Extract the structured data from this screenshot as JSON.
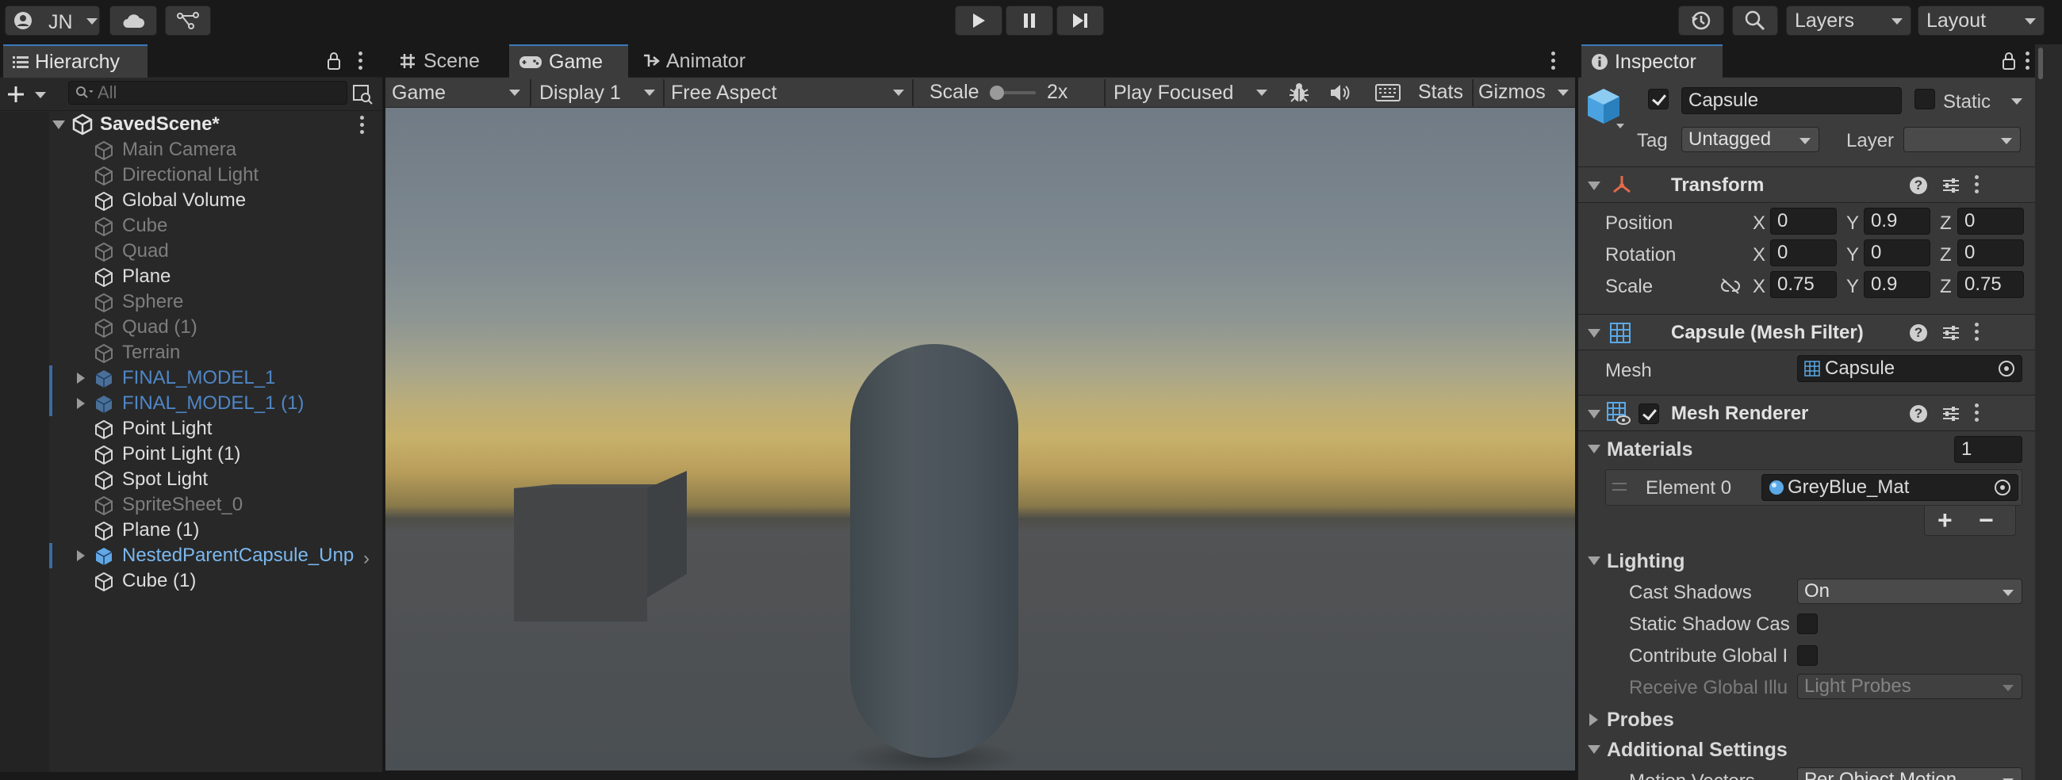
{
  "toolbar": {
    "account": "JN",
    "layers": "Layers",
    "layout": "Layout"
  },
  "hierarchy": {
    "tab": "Hierarchy",
    "search_placeholder": "All",
    "scene": "SavedScene*",
    "items": [
      {
        "label": "Main Camera",
        "style": "dim"
      },
      {
        "label": "Directional Light",
        "style": "dim"
      },
      {
        "label": "Global Volume",
        "style": "norm"
      },
      {
        "label": "Cube",
        "style": "dim"
      },
      {
        "label": "Quad",
        "style": "dim"
      },
      {
        "label": "Plane",
        "style": "norm"
      },
      {
        "label": "Sphere",
        "style": "dim"
      },
      {
        "label": "Quad (1)",
        "style": "dim"
      },
      {
        "label": "Terrain",
        "style": "dim"
      },
      {
        "label": "FINAL_MODEL_1",
        "style": "prefab"
      },
      {
        "label": "FINAL_MODEL_1 (1)",
        "style": "prefab"
      },
      {
        "label": "Point Light",
        "style": "norm"
      },
      {
        "label": "Point Light (1)",
        "style": "norm"
      },
      {
        "label": "Spot Light",
        "style": "norm"
      },
      {
        "label": "SpriteSheet_0",
        "style": "dim"
      },
      {
        "label": "Plane (1)",
        "style": "norm"
      },
      {
        "label": "NestedParentCapsule_Unp",
        "style": "prefab-bright"
      },
      {
        "label": "Cube (1)",
        "style": "norm"
      }
    ]
  },
  "center": {
    "tabs": {
      "scene": "Scene",
      "game": "Game",
      "animator": "Animator"
    },
    "game_toolbar": {
      "view": "Game",
      "display": "Display 1",
      "aspect": "Free Aspect",
      "scale_label": "Scale",
      "scale_value": "2x",
      "play_mode": "Play Focused",
      "stats": "Stats",
      "gizmos": "Gizmos"
    }
  },
  "inspector": {
    "tab": "Inspector",
    "object_name": "Capsule",
    "static_label": "Static",
    "tag_label": "Tag",
    "tag_value": "Untagged",
    "layer_label": "Layer",
    "transform": {
      "title": "Transform",
      "position_label": "Position",
      "rotation_label": "Rotation",
      "scale_label": "Scale",
      "axis_x": "X",
      "axis_y": "Y",
      "axis_z": "Z",
      "position": {
        "x": "0",
        "y": "0.9",
        "z": "0"
      },
      "rotation": {
        "x": "0",
        "y": "0",
        "z": "0"
      },
      "scale": {
        "x": "0.75",
        "y": "0.9",
        "z": "0.75"
      }
    },
    "mesh_filter": {
      "title": "Capsule (Mesh Filter)",
      "mesh_label": "Mesh",
      "mesh_value": "Capsule"
    },
    "mesh_renderer": {
      "title": "Mesh Renderer",
      "materials_label": "Materials",
      "materials_count": "1",
      "element_label": "Element 0",
      "element_value": "GreyBlue_Mat",
      "add": "+",
      "remove": "−",
      "lighting_label": "Lighting",
      "cast_shadows_label": "Cast Shadows",
      "cast_shadows_value": "On",
      "static_shadow_label": "Static Shadow Cas",
      "contribute_gi_label": "Contribute Global I",
      "receive_gi_label": "Receive Global Illu",
      "receive_gi_value": "Light Probes",
      "probes_label": "Probes",
      "additional_label": "Additional Settings",
      "motion_label": "Motion Vectors",
      "motion_value": "Per Object Motion"
    }
  }
}
